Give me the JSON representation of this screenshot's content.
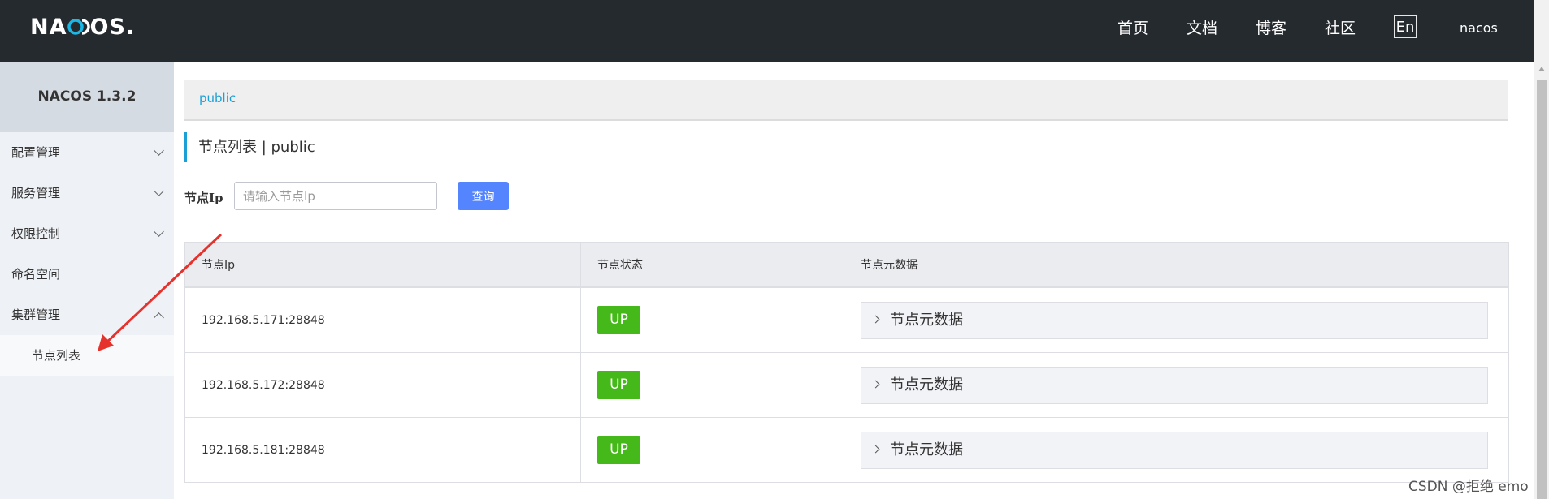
{
  "header": {
    "logo": "NACOS.",
    "nav": [
      "首页",
      "文档",
      "博客",
      "社区"
    ],
    "lang_button": "En",
    "user": "nacos"
  },
  "sidebar": {
    "brand": "NACOS 1.3.2",
    "items": [
      {
        "label": "配置管理",
        "chevron": "chevron-down-icon"
      },
      {
        "label": "服务管理",
        "chevron": "chevron-down-icon"
      },
      {
        "label": "权限控制",
        "chevron": "chevron-down-icon"
      },
      {
        "label": "命名空间"
      },
      {
        "label": "集群管理",
        "chevron": "chevron-up-icon"
      }
    ],
    "sub_items": [
      {
        "label": "节点列表"
      }
    ]
  },
  "main": {
    "namespace_tab": "public",
    "title": "节点列表  |  public",
    "search": {
      "label": "节点Ip",
      "placeholder": "请输入节点Ip",
      "value": "",
      "button": "查询"
    },
    "table": {
      "columns": [
        "节点Ip",
        "节点状态",
        "节点元数据"
      ],
      "rows": [
        {
          "ip": "192.168.5.171:28848",
          "status": "UP",
          "meta": "节点元数据"
        },
        {
          "ip": "192.168.5.172:28848",
          "status": "UP",
          "meta": "节点元数据"
        },
        {
          "ip": "192.168.5.181:28848",
          "status": "UP",
          "meta": "节点元数据"
        }
      ]
    }
  },
  "colors": {
    "header_bg": "#252a2f",
    "accent": "#1aa0d6",
    "primary_button": "#5584ff",
    "status_up": "#46b91a",
    "annotation_arrow": "#e5322d"
  },
  "watermark": "CSDN @拒绝 emo"
}
